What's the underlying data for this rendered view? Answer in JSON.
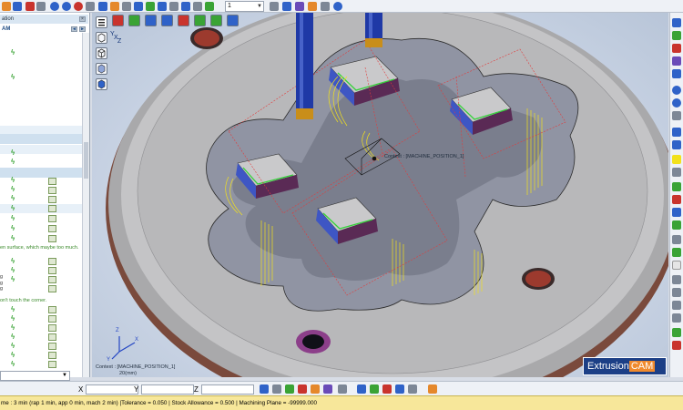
{
  "toolbar": {
    "zoom_value": "1",
    "icons": [
      "open-icon",
      "save-icon",
      "tool-icon",
      "pin-icon",
      "globe-icon",
      "sphere-icon",
      "target-icon",
      "camera-icon",
      "grid-icon",
      "layers-icon",
      "cut-icon",
      "cube-icon",
      "cube-icon",
      "zoom-icon",
      "rotate-icon",
      "pan-icon",
      "fit-icon",
      "wire-icon",
      "view-icon",
      "select-icon",
      "shade-icon",
      "box-icon",
      "arrow-icon",
      "help-icon"
    ],
    "colors": {
      "blue": "#2f62c8",
      "red": "#c9342d",
      "green": "#3aa335",
      "orange": "#e5882b",
      "gray": "#7d8796",
      "purple": "#6a4bb8"
    }
  },
  "left_panel": {
    "title": "ation",
    "group_label": "AM",
    "notes": [
      "en surface, which maybe too much.",
      "on't touch the corner."
    ],
    "chars": [
      "g",
      "g",
      "g"
    ]
  },
  "viewport": {
    "context_label": "Context : [MACHINE_POSITION_1]",
    "center_label": "Context : [MACHINE_POSITION_1]",
    "scale_label": "20(mm)",
    "axis_x": "X",
    "axis_y": "Y",
    "axis_z": "Z",
    "brand_main": "Extrusion",
    "brand_accent": "CAM",
    "view_axis_letters": "Y",
    "view_axis_z": "Z",
    "view_axis_x": "X"
  },
  "coordinates": {
    "x_label": "X",
    "y_label": "Y",
    "z_label": "Z",
    "x_value": "",
    "y_value": "",
    "z_value": ""
  },
  "status_bar": {
    "text": "me : 3 min (rap 1 min, app 0 min, mach 2 min) |Tolerance = 0.050 | Stock Allowance = 0.500 | Machining Plane = -99999.000"
  }
}
